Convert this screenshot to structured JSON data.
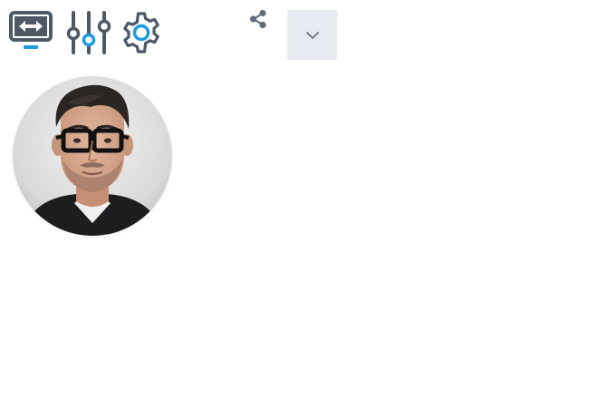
{
  "toolbar": {
    "display_icon": "display-swap-icon",
    "sliders_icon": "sliders-icon",
    "settings_icon": "gear-icon",
    "share_icon": "share-icon",
    "dropdown_icon": "chevron-down-icon"
  },
  "colors": {
    "icon_dark": "#4d5a66",
    "icon_accent": "#1e9be0",
    "dropdown_bg": "#e8eaf2",
    "share_icon": "#5f6b76"
  },
  "profile": {
    "avatar": "profile-photo"
  }
}
